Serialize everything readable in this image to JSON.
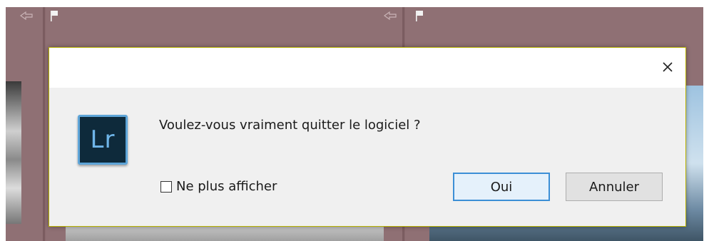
{
  "dialog": {
    "message": "Voulez-vous vraiment quitter le logiciel ?",
    "checkbox_label": "Ne plus afficher",
    "checkbox_checked": false,
    "ok_label": "Oui",
    "cancel_label": "Annuler",
    "close_glyph": "✕",
    "app_icon_text": "Lr"
  },
  "colors": {
    "accent": "#3c8fd6",
    "app_icon_bg": "#0e2a3b",
    "app_icon_fg": "#6fb6ea",
    "background": "#8a6a6e"
  },
  "icons": {
    "close": "close-icon",
    "flag": "flag-icon",
    "rotate": "rotate-icon",
    "app": "lightroom-icon"
  }
}
